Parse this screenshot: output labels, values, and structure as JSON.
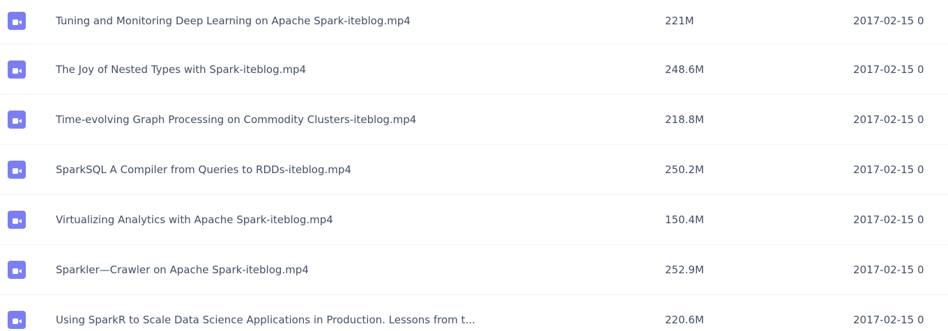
{
  "colors": {
    "video_icon": "#7b7ef2",
    "text": "#424e67",
    "divider": "#f1f2f4"
  },
  "files": [
    {
      "icon": "video-file-icon",
      "name": "Tuning and Monitoring Deep Learning on Apache Spark-iteblog.mp4",
      "size": "221M",
      "date": "2017-02-15 0"
    },
    {
      "icon": "video-file-icon",
      "name": "The Joy of Nested Types with Spark-iteblog.mp4",
      "size": "248.6M",
      "date": "2017-02-15 0"
    },
    {
      "icon": "video-file-icon",
      "name": "Time-evolving Graph Processing on Commodity Clusters-iteblog.mp4",
      "size": "218.8M",
      "date": "2017-02-15 0"
    },
    {
      "icon": "video-file-icon",
      "name": "SparkSQL A Compiler from Queries to RDDs-iteblog.mp4",
      "size": "250.2M",
      "date": "2017-02-15 0"
    },
    {
      "icon": "video-file-icon",
      "name": "Virtualizing Analytics with Apache Spark-iteblog.mp4",
      "size": "150.4M",
      "date": "2017-02-15 0"
    },
    {
      "icon": "video-file-icon",
      "name": "Sparkler—Crawler on Apache Spark-iteblog.mp4",
      "size": "252.9M",
      "date": "2017-02-15 0"
    },
    {
      "icon": "video-file-icon",
      "name": "Using SparkR to Scale Data Science Applications in Production. Lessons from t...",
      "size": "220.6M",
      "date": "2017-02-15 0"
    }
  ]
}
